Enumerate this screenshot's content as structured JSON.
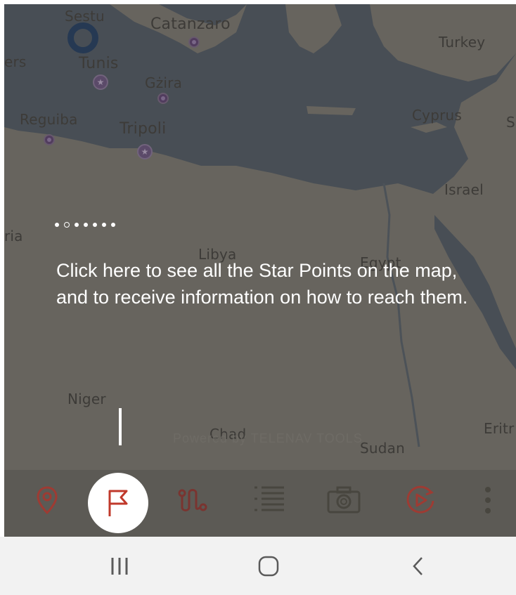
{
  "map": {
    "labels": {
      "sestu": "Sestu",
      "catanzaro": "Catanzaro",
      "turkey": "Turkey",
      "ers": "ers",
      "tunis": "Tunis",
      "gzira": "Gżira",
      "reguiba": "Reguiba",
      "tripoli": "Tripoli",
      "cyprus": "Cyprus",
      "s_edge": "S",
      "israel": "Israel",
      "ria": "ria",
      "libya": "Libya",
      "egypt": "Egypt",
      "niger": "Niger",
      "chad": "Chad",
      "sudan": "Sudan",
      "eritrea": "Eritr"
    },
    "watermark": "Powered by TELENAV TOOLS"
  },
  "tooltip": {
    "text": "Click here to see all the Star Points on the map, and to receive information on how to reach them.",
    "page_dots": 7,
    "active_dot_index": 1
  },
  "toolbar": {
    "items": [
      {
        "name": "location-pin-icon"
      },
      {
        "name": "flag-icon"
      },
      {
        "name": "route-icon"
      },
      {
        "name": "list-icon"
      },
      {
        "name": "camera-icon"
      },
      {
        "name": "replay-icon"
      },
      {
        "name": "more-vertical-icon"
      }
    ],
    "active": "flag-icon"
  },
  "system_nav": {
    "items": [
      "recent-apps-icon",
      "home-icon",
      "back-icon"
    ]
  },
  "colors": {
    "accent_red": "#c0392b",
    "map_sea": "#3e4b5a",
    "map_land": "#7e7b73",
    "toolbar_bg": "#5c5a55"
  }
}
